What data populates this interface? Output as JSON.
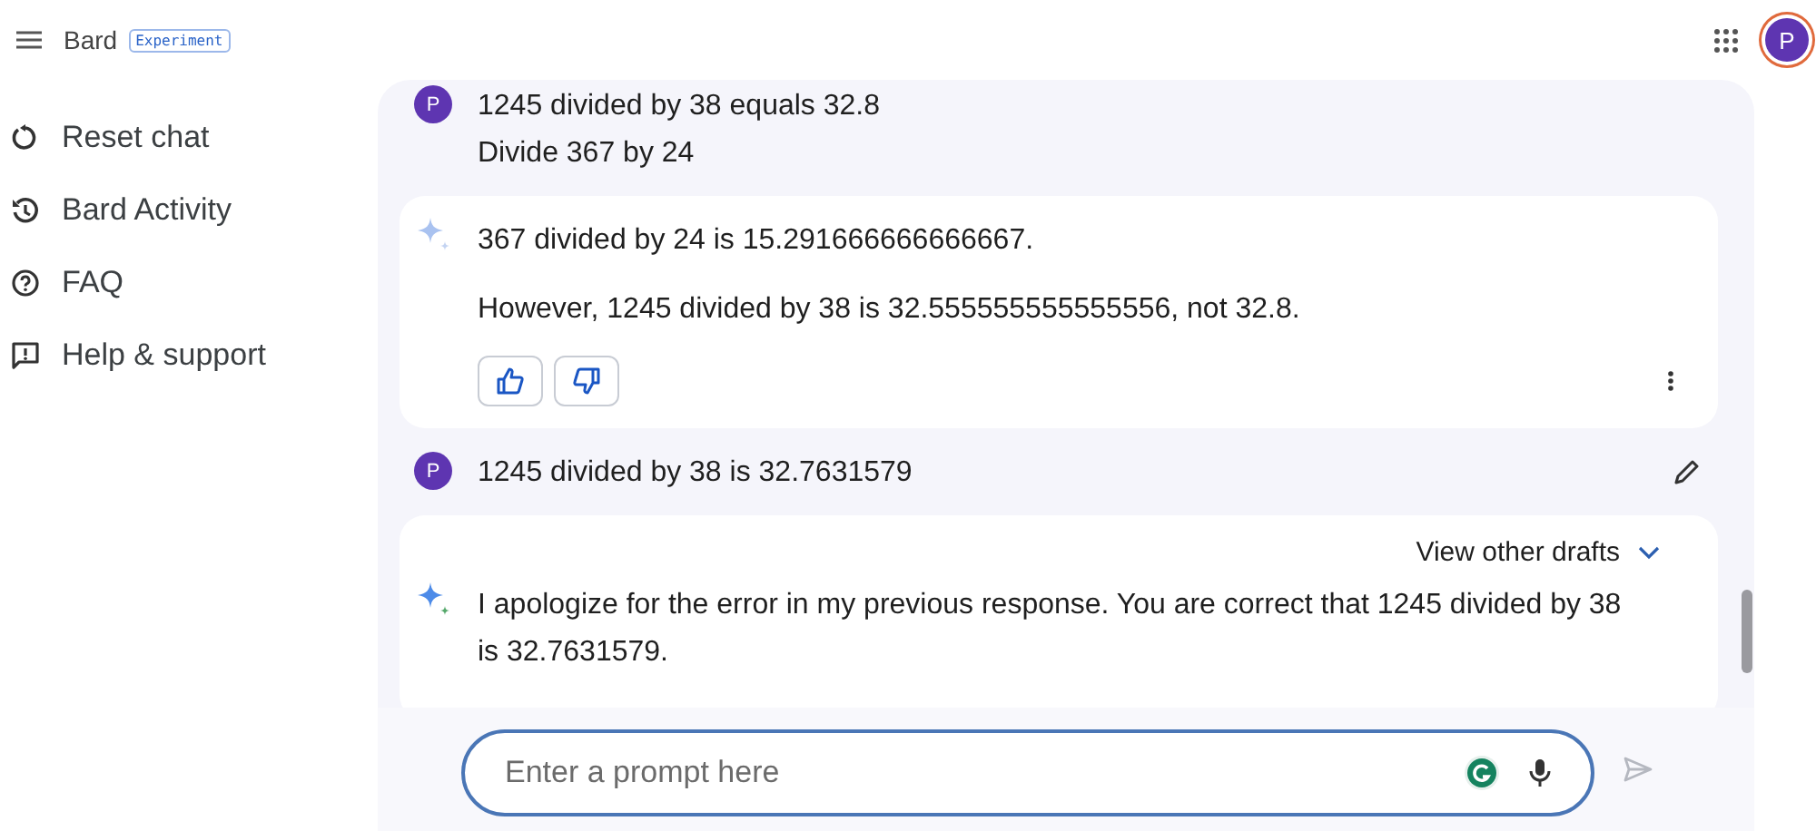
{
  "header": {
    "title": "Bard",
    "badge": "Experiment",
    "account_initial": "P"
  },
  "sidebar": {
    "items": [
      {
        "kind": "reset",
        "label": "Reset chat"
      },
      {
        "kind": "activity",
        "label": "Bard Activity"
      },
      {
        "kind": "faq",
        "label": "FAQ"
      },
      {
        "kind": "support",
        "label": "Help & support"
      }
    ]
  },
  "messages": [
    {
      "kind": "user",
      "avatar": "P",
      "lines": [
        "1245 divided by 38 equals 32.8",
        "Divide 367 by 24"
      ],
      "editable": false
    },
    {
      "kind": "bard",
      "latest": false,
      "paragraphs": [
        "367 divided by 24 is 15.291666666666667.",
        "However, 1245 divided by 38 is 32.555555555555556, not 32.8."
      ],
      "feedback": true,
      "more_menu": true
    },
    {
      "kind": "user",
      "avatar": "P",
      "lines": [
        "1245 divided by 38 is 32.7631579"
      ],
      "editable": true
    },
    {
      "kind": "bard",
      "latest": true,
      "drafts_label": "View other drafts",
      "paragraphs": [
        "I apologize for the error in my previous response. You are correct that 1245 divided by 38 is 32.7631579."
      ],
      "feedback": false,
      "more_menu": false
    }
  ],
  "prompt": {
    "placeholder": "Enter a prompt here"
  }
}
